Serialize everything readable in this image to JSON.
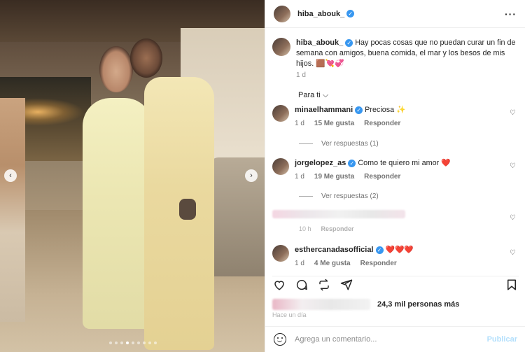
{
  "post": {
    "username": "hiba_abouk_",
    "more_label": "···"
  },
  "caption": {
    "username": "hiba_abouk_",
    "text": "Hay pocas cosas que no puedan curar un fin de semana con amigos, buena comida, el mar y los besos de mis hijos. 🟫💘💞",
    "time": "1 d"
  },
  "sort_label": "Para ti ⌵",
  "comments": [
    {
      "username": "minaelhammani",
      "text": "Preciosa ✨",
      "time": "1 d",
      "likes": "15 Me gusta",
      "reply": "Responder",
      "view_replies": "Ver respuestas (1)"
    },
    {
      "username": "jorgelopez_as",
      "text": "Como te quiero mi amor ❤️",
      "time": "1 d",
      "likes": "19 Me gusta",
      "reply": "Responder",
      "view_replies": "Ver respuestas (2)"
    },
    {
      "username": "",
      "text": "",
      "time": "10 h",
      "likes": "",
      "reply": "Responder"
    },
    {
      "username": "esthercanadasofficial",
      "text": "❤️❤️❤️",
      "time": "1 d",
      "likes": "4 Me gusta",
      "reply": "Responder"
    }
  ],
  "likes_text": "24,3 mil personas más",
  "hace": "Hace un día",
  "add_comment": {
    "placeholder": "Agrega un comentario...",
    "publish": "Publicar"
  },
  "carousel": {
    "total_dots": 9,
    "active_index": 3
  },
  "colors": {
    "verified": "#3897f0",
    "publish": "#b2dffc"
  }
}
